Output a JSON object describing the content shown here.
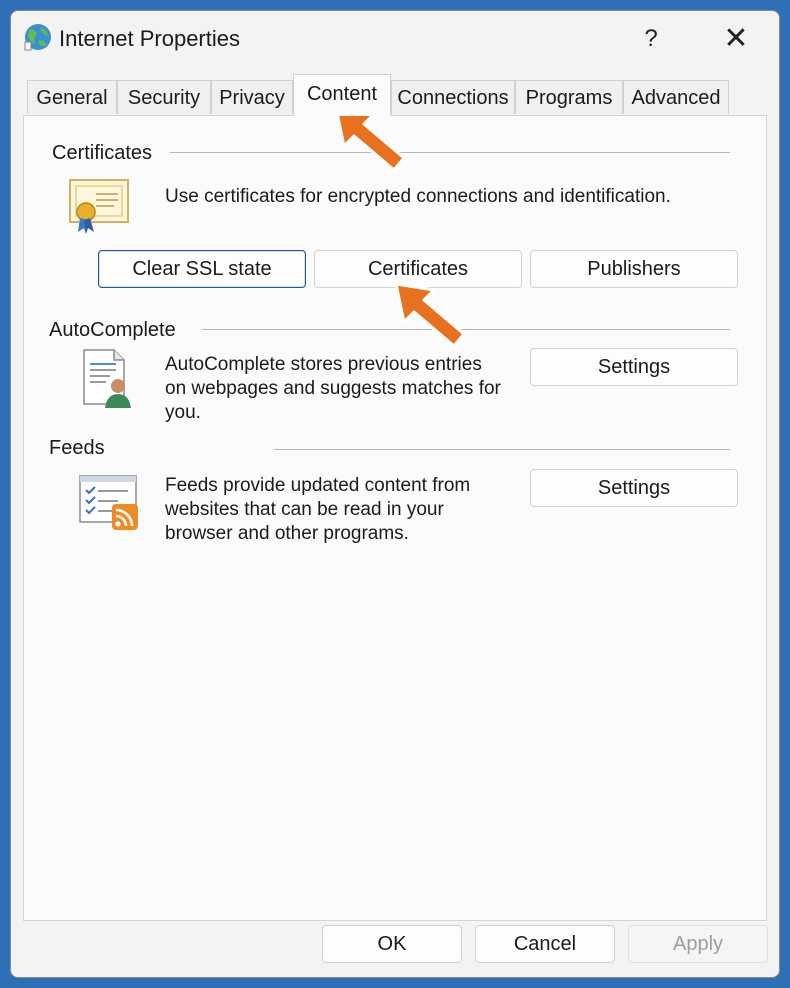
{
  "window": {
    "title": "Internet Properties",
    "help_glyph": "?",
    "close_glyph": "✕"
  },
  "tabs": [
    {
      "label": "General"
    },
    {
      "label": "Security"
    },
    {
      "label": "Privacy"
    },
    {
      "label": "Content",
      "active": true
    },
    {
      "label": "Connections"
    },
    {
      "label": "Programs"
    },
    {
      "label": "Advanced"
    }
  ],
  "certificates": {
    "group_label": "Certificates",
    "description": "Use certificates for encrypted connections and identification.",
    "buttons": {
      "clear_ssl": "Clear SSL state",
      "certificates": "Certificates",
      "publishers": "Publishers"
    },
    "icon": "certificate-icon"
  },
  "autocomplete": {
    "group_label": "AutoComplete",
    "description_lines": [
      "AutoComplete stores previous entries",
      "on webpages and suggests matches for",
      "you."
    ],
    "settings_label": "Settings",
    "icon": "autocomplete-icon"
  },
  "feeds": {
    "group_label": "Feeds",
    "description_lines": [
      "Feeds provide updated content from",
      "websites that can be read in your",
      "browser and other programs."
    ],
    "settings_label": "Settings",
    "icon": "feeds-icon"
  },
  "footer": {
    "ok": "OK",
    "cancel": "Cancel",
    "apply": "Apply"
  },
  "colors": {
    "annotation_arrow": "#e8711f",
    "focus_border": "#1f5a93"
  }
}
